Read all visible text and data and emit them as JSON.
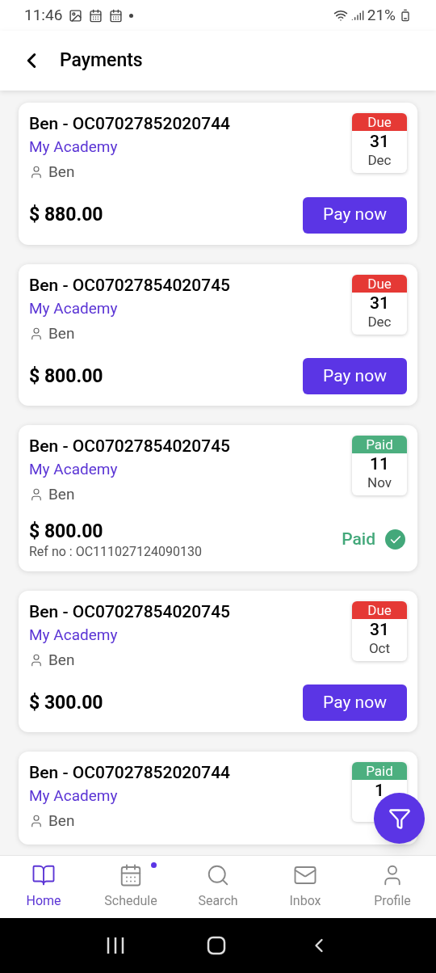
{
  "status_bar": {
    "time": "11:46",
    "battery": "21%"
  },
  "header": {
    "title": "Payments"
  },
  "payments": [
    {
      "title": "Ben - OC07027852020744",
      "academy": "My Academy",
      "student": "Ben",
      "status": "Due",
      "day": "31",
      "month": "Dec",
      "amount": "$ 880.00",
      "action": "Pay now"
    },
    {
      "title": "Ben - OC07027854020745",
      "academy": "My Academy",
      "student": "Ben",
      "status": "Due",
      "day": "31",
      "month": "Dec",
      "amount": "$ 800.00",
      "action": "Pay now"
    },
    {
      "title": "Ben - OC07027854020745",
      "academy": "My Academy",
      "student": "Ben",
      "status": "Paid",
      "day": "11",
      "month": "Nov",
      "amount": "$ 800.00",
      "ref": "Ref no : OC111027124090130",
      "paid_label": "Paid"
    },
    {
      "title": "Ben - OC07027854020745",
      "academy": "My Academy",
      "student": "Ben",
      "status": "Due",
      "day": "31",
      "month": "Oct",
      "amount": "$ 300.00",
      "action": "Pay now"
    },
    {
      "title": "Ben - OC07027852020744",
      "academy": "My Academy",
      "student": "Ben",
      "status": "Paid",
      "day": "1"
    }
  ],
  "nav": [
    {
      "label": "Home",
      "selected": true,
      "dot": false
    },
    {
      "label": "Schedule",
      "selected": false,
      "dot": true
    },
    {
      "label": "Search",
      "selected": false,
      "dot": false
    },
    {
      "label": "Inbox",
      "selected": false,
      "dot": false
    },
    {
      "label": "Profile",
      "selected": false,
      "dot": false
    }
  ]
}
